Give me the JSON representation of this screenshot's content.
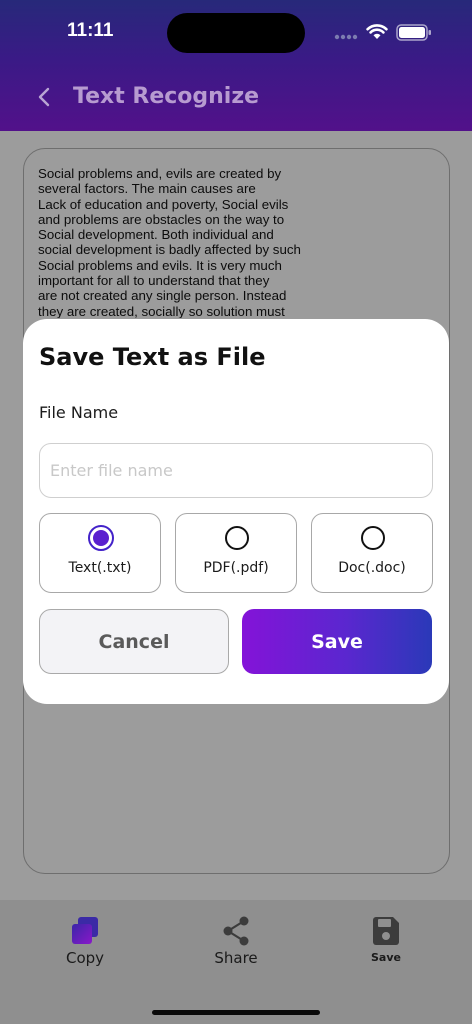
{
  "status_bar": {
    "time": "11:11"
  },
  "header": {
    "title": "Text Recognize"
  },
  "content": {
    "recognized_text": "Social problems and, evils are created by\nseveral factors. The main causes are\nLack of education and poverty, Social evils\nand problems are obstacles on the way to\nSocial development. Both individual and\nsocial development is badly affected by such\nSocial problems and evils. It is very much\nimportant for all to understand that they\nare not created any single person. Instead\nthey are created, socially so solution must"
  },
  "dialog": {
    "title": "Save Text as File",
    "field_label": "File Name",
    "input_placeholder": "Enter file name",
    "input_value": "",
    "formats": [
      {
        "label": "Text(.txt)",
        "selected": true
      },
      {
        "label": "PDF(.pdf)",
        "selected": false
      },
      {
        "label": "Doc(.doc)",
        "selected": false
      }
    ],
    "cancel_label": "Cancel",
    "save_label": "Save"
  },
  "bottom_bar": {
    "copy_label": "Copy",
    "share_label": "Share",
    "save_label": "Save"
  },
  "colors": {
    "accent_start": "#8413d8",
    "accent_end": "#2a39b8",
    "radio_selected": "#5a1fcf"
  }
}
